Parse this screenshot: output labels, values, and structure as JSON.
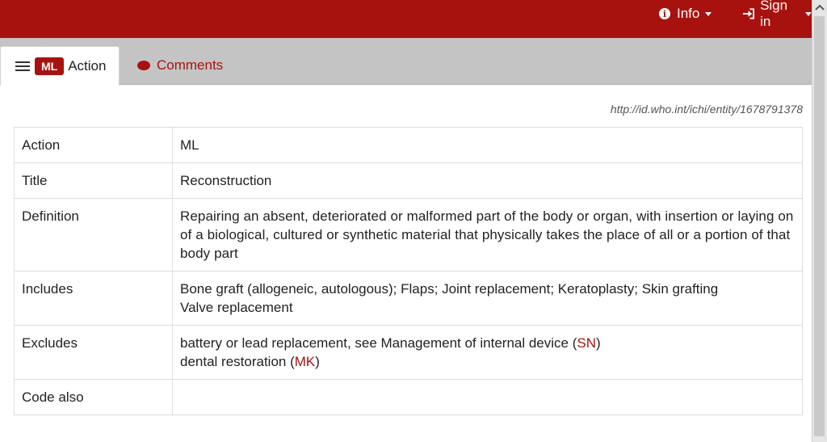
{
  "nav": {
    "info_label": "Info",
    "signin_label": "Sign in"
  },
  "tabs": {
    "active_badge": "ML",
    "active_label": "Action",
    "comments_label": "Comments"
  },
  "uri": "http://id.who.int/ichi/entity/1678791378",
  "table": {
    "action": {
      "label": "Action",
      "value": "ML"
    },
    "title": {
      "label": "Title",
      "value": "Reconstruction"
    },
    "definition": {
      "label": "Definition",
      "value": "Repairing an absent, deteriorated or malformed part of the body or organ, with insertion or laying on of a biological, cultured or synthetic material that physically takes the place of all or a portion of that body part"
    },
    "includes": {
      "label": "Includes",
      "lines": [
        "Bone graft (allogeneic, autologous); Flaps; Joint replacement; Keratoplasty; Skin grafting",
        "Valve replacement"
      ]
    },
    "excludes": {
      "label": "Excludes",
      "items": [
        {
          "text": "battery or lead replacement, see Management of internal device (",
          "code": "SN",
          "end": ")"
        },
        {
          "text": "dental restoration (",
          "code": "MK",
          "end": ")"
        }
      ]
    },
    "code_also": {
      "label": "Code also",
      "value": ""
    }
  },
  "colors": {
    "brand": "#a8120e"
  }
}
